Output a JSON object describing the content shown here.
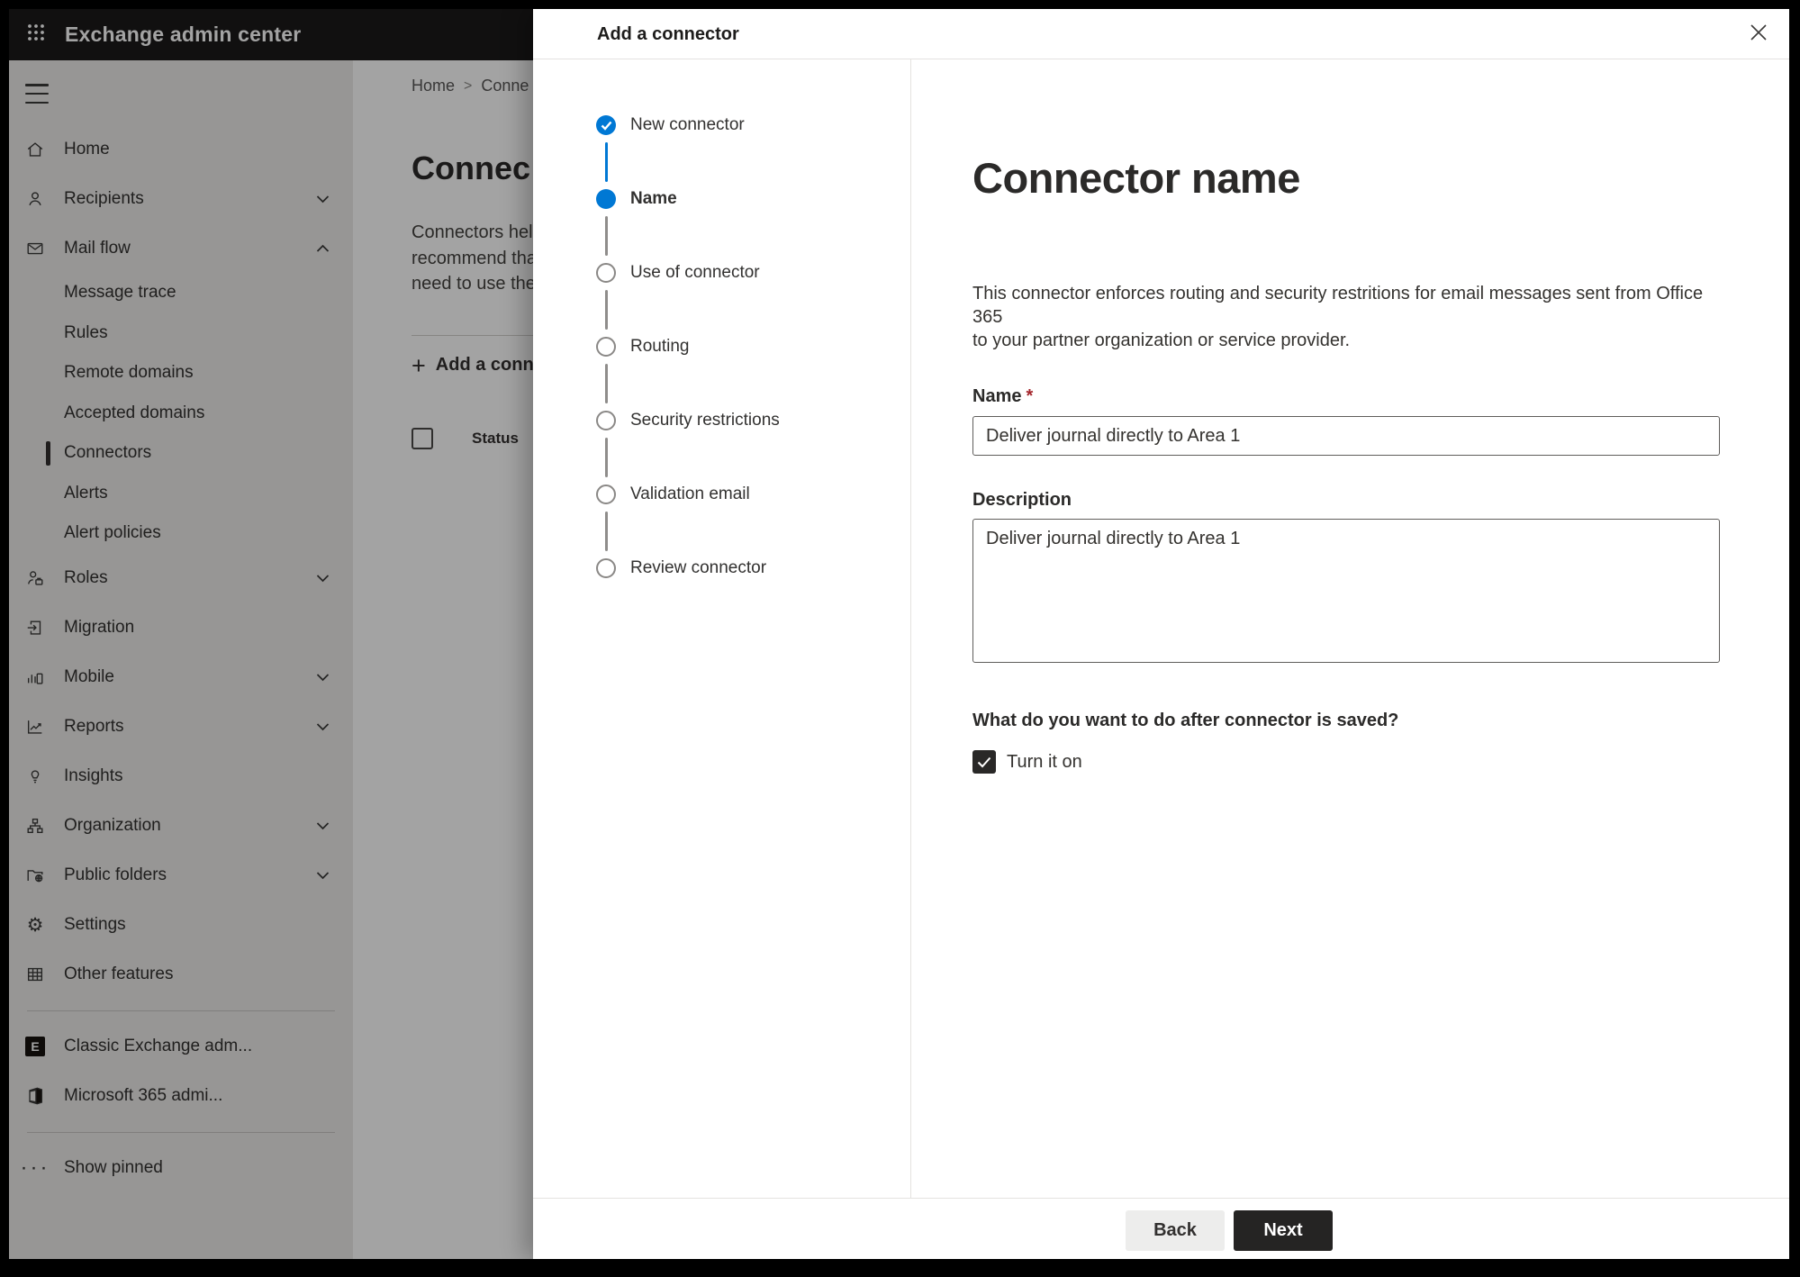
{
  "topbar": {
    "title": "Exchange admin center"
  },
  "sidebar": {
    "items": [
      {
        "label": "Home",
        "icon": "home-icon"
      },
      {
        "label": "Recipients",
        "icon": "person-icon",
        "chevron": "down"
      },
      {
        "label": "Mail flow",
        "icon": "mail-icon",
        "chevron": "up"
      },
      {
        "label": "Message trace",
        "sub": true
      },
      {
        "label": "Rules",
        "sub": true
      },
      {
        "label": "Remote domains",
        "sub": true
      },
      {
        "label": "Accepted domains",
        "sub": true
      },
      {
        "label": "Connectors",
        "sub": true,
        "selected": true
      },
      {
        "label": "Alerts",
        "sub": true
      },
      {
        "label": "Alert policies",
        "sub": true
      },
      {
        "label": "Roles",
        "icon": "roles-icon",
        "chevron": "down"
      },
      {
        "label": "Migration",
        "icon": "migration-icon"
      },
      {
        "label": "Mobile",
        "icon": "mobile-icon",
        "chevron": "down"
      },
      {
        "label": "Reports",
        "icon": "reports-icon",
        "chevron": "down"
      },
      {
        "label": "Insights",
        "icon": "lightbulb-icon"
      },
      {
        "label": "Organization",
        "icon": "org-chart-icon",
        "chevron": "down"
      },
      {
        "label": "Public folders",
        "icon": "folder-globe-icon",
        "chevron": "down"
      },
      {
        "label": "Settings",
        "icon": "gear-icon"
      },
      {
        "label": "Other features",
        "icon": "grid-icon"
      }
    ],
    "footer_items": [
      {
        "label": "Classic Exchange adm...",
        "icon": "exchange-logo-icon"
      },
      {
        "label": "Microsoft 365 admi...",
        "icon": "microsoft-365-logo-icon"
      },
      {
        "label": "Show pinned",
        "icon": "ellipsis-icon"
      }
    ]
  },
  "page": {
    "breadcrumb": [
      "Home",
      "Conne"
    ],
    "heading": "Connec",
    "intro_lines": [
      "Connectors help",
      "recommend that",
      "need to use ther"
    ],
    "add_button_label": "Add a conn",
    "table": {
      "status_header": "Status"
    }
  },
  "dialog": {
    "title": "Add a connector",
    "steps": [
      {
        "label": "New connector",
        "state": "done"
      },
      {
        "label": "Name",
        "state": "current"
      },
      {
        "label": "Use of connector",
        "state": "todo"
      },
      {
        "label": "Routing",
        "state": "todo"
      },
      {
        "label": "Security restrictions",
        "state": "todo"
      },
      {
        "label": "Validation email",
        "state": "todo"
      },
      {
        "label": "Review connector",
        "state": "todo"
      }
    ],
    "content": {
      "heading": "Connector name",
      "description_lines": [
        "This connector enforces routing and security restritions for email messages sent from Office 365",
        "to your partner organization or service provider."
      ],
      "name_label": "Name",
      "required_marker": "*",
      "name_value": "Deliver journal directly to Area 1",
      "description_label": "Description",
      "description_value": "Deliver journal directly to Area 1",
      "after_save_question": "What do you want to do after connector is saved?",
      "turn_on_label": "Turn it on",
      "turn_on_checked": true
    },
    "footer": {
      "back_label": "Back",
      "next_label": "Next"
    }
  },
  "colors": {
    "accent": "#0078d4",
    "required_marker": "#a4262c",
    "topbar_bg": "#1b1a19",
    "next_button_bg": "#252423",
    "selected_indicator": "#32302f"
  }
}
